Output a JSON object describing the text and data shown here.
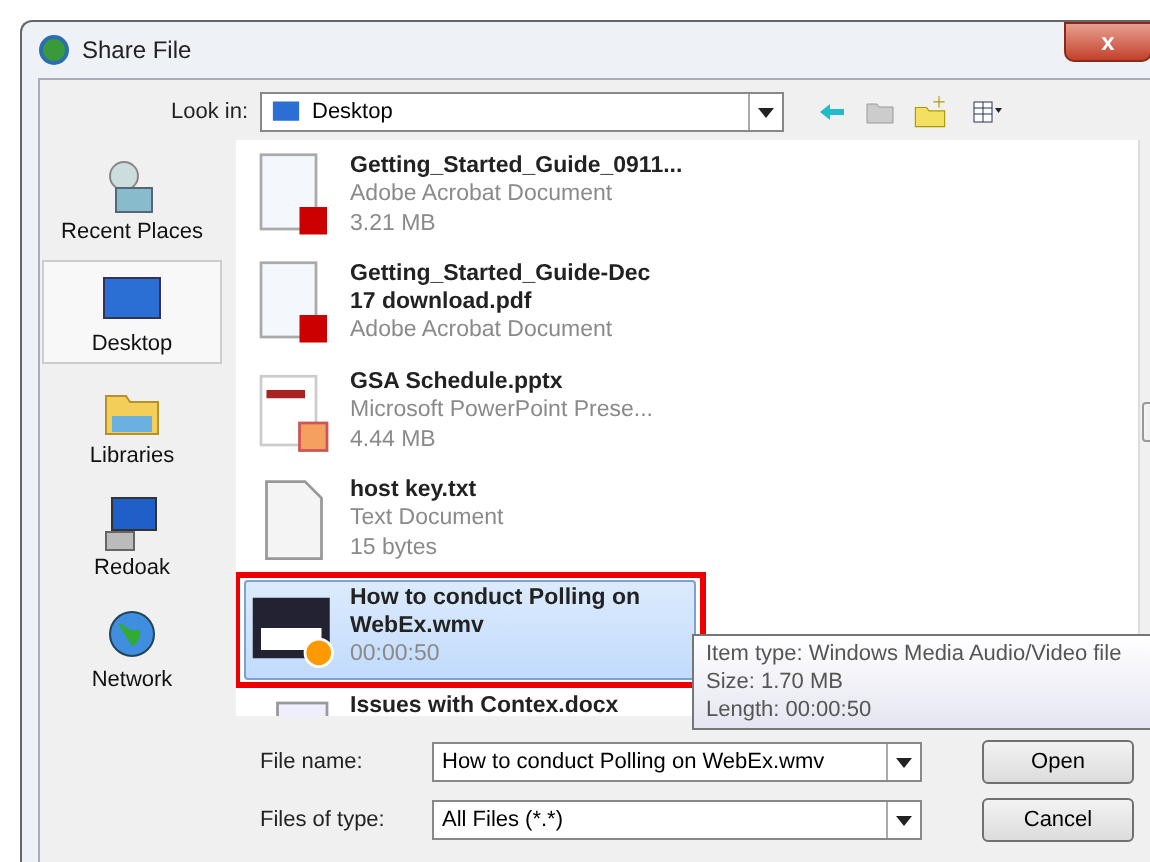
{
  "window": {
    "title": "Share File",
    "close": "x"
  },
  "look_in": {
    "label": "Look in:",
    "value": "Desktop"
  },
  "places": [
    {
      "label": "Recent Places",
      "kind": "recent",
      "selected": false
    },
    {
      "label": "Desktop",
      "kind": "desktop",
      "selected": true
    },
    {
      "label": "Libraries",
      "kind": "libraries",
      "selected": false
    },
    {
      "label": "Redoak",
      "kind": "computer",
      "selected": false
    },
    {
      "label": "Network",
      "kind": "network",
      "selected": false
    }
  ],
  "files": [
    {
      "kind": "pdf",
      "name": "Getting_Started_Guide_0911...",
      "type": "Adobe Acrobat Document",
      "size": "3.21 MB",
      "selected": false,
      "highlighted": false
    },
    {
      "kind": "pdf",
      "name": "Getting_Started_Guide-Dec 17 download.pdf",
      "type": "Adobe Acrobat Document",
      "selected": false,
      "highlighted": false
    },
    {
      "kind": "pptx",
      "name": "GSA Schedule.pptx",
      "type": "Microsoft PowerPoint Prese...",
      "size": "4.44 MB",
      "selected": false,
      "highlighted": false
    },
    {
      "kind": "txt",
      "name": "host key.txt",
      "type": "Text Document",
      "size": "15 bytes",
      "selected": false,
      "highlighted": false
    },
    {
      "kind": "wmv",
      "name": "How to conduct Polling on WebEx.wmv",
      "size": "00:00:50",
      "selected": true,
      "highlighted": true
    },
    {
      "kind": "docx",
      "name": "Issues with Contex.docx",
      "selected": false,
      "highlighted": false
    }
  ],
  "tooltip": [
    "Item type: Windows Media Audio/Video file",
    "Size: 1.70 MB",
    "Length: 00:00:50"
  ],
  "file_name": {
    "label": "File name:",
    "value": "How to conduct Polling on WebEx.wmv"
  },
  "file_type": {
    "label": "Files of type:",
    "value": "All Files (*.*)"
  },
  "buttons": [
    "Open",
    "Cancel"
  ]
}
